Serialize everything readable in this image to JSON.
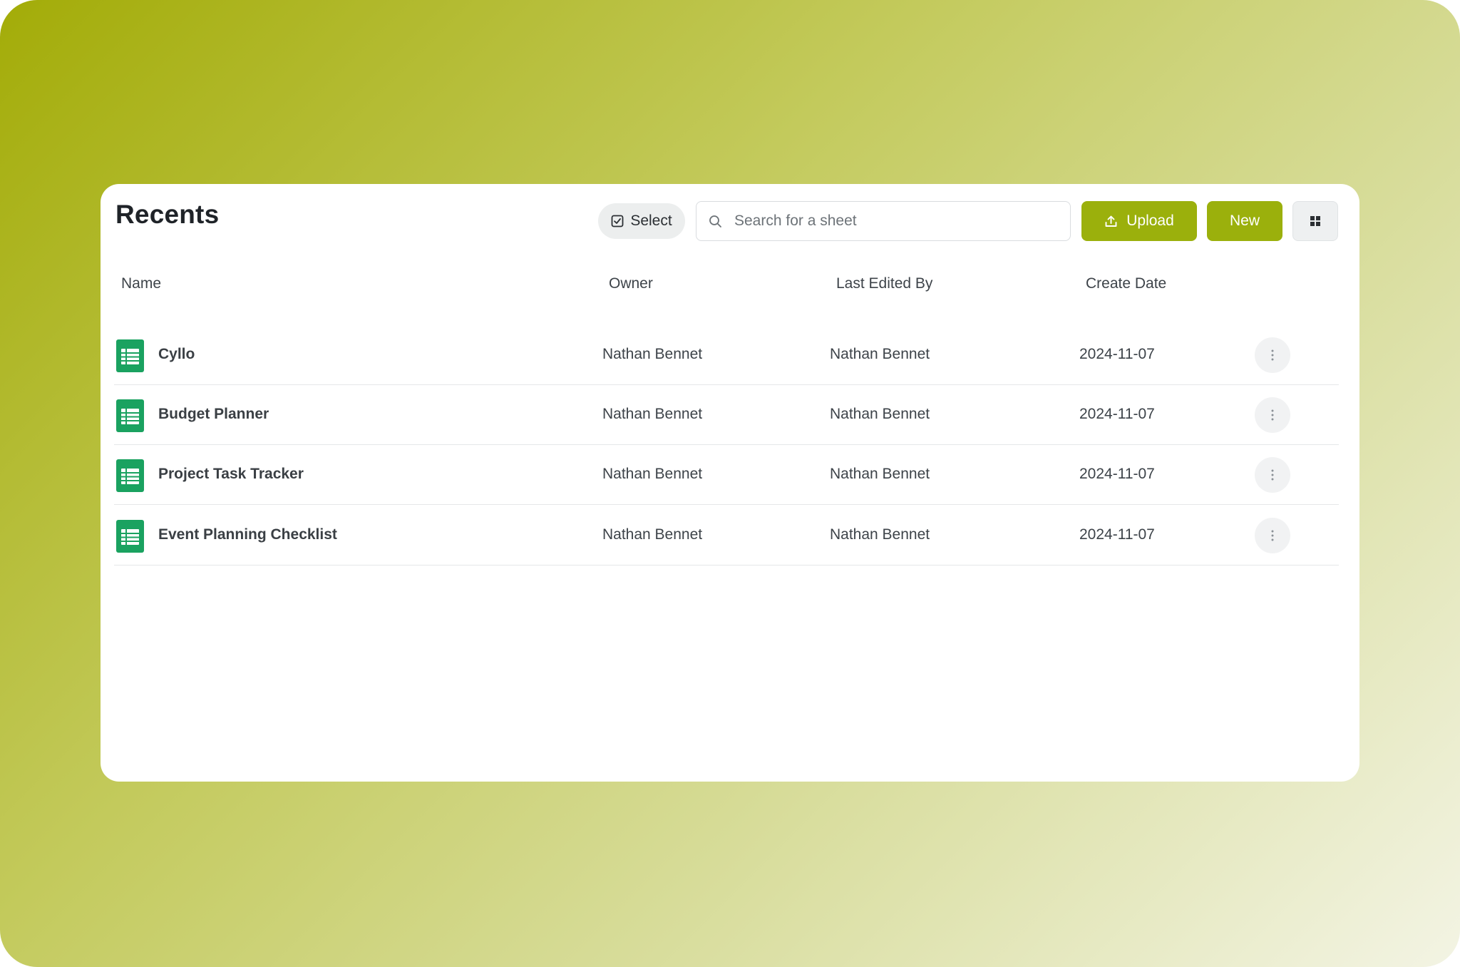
{
  "header": {
    "title": "Recents",
    "select_label": "Select",
    "search_placeholder": "Search for a sheet",
    "upload_label": "Upload",
    "new_label": "New"
  },
  "columns": {
    "name": "Name",
    "owner": "Owner",
    "last_edited_by": "Last Edited By",
    "create_date": "Create Date"
  },
  "files": [
    {
      "name": "Cyllo",
      "owner": "Nathan Bennet",
      "last_edited_by": "Nathan Bennet",
      "create_date": "2024-11-07"
    },
    {
      "name": "Budget Planner",
      "owner": "Nathan Bennet",
      "last_edited_by": "Nathan Bennet",
      "create_date": "2024-11-07"
    },
    {
      "name": "Project Task Tracker",
      "owner": "Nathan Bennet",
      "last_edited_by": "Nathan Bennet",
      "create_date": "2024-11-07"
    },
    {
      "name": "Event Planning Checklist",
      "owner": "Nathan Bennet",
      "last_edited_by": "Nathan Bennet",
      "create_date": "2024-11-07"
    }
  ],
  "icons": {
    "select": "checkbox-icon",
    "search": "search-icon",
    "upload": "upload-icon",
    "grid_view": "grid-view-icon",
    "file": "spreadsheet-icon",
    "row_menu": "more-vertical-icon"
  },
  "colors": {
    "accent": "#9bb00c",
    "sheet_icon": "#1aa260",
    "background_start": "#a3ac08",
    "background_end": "#f3f4e4"
  }
}
